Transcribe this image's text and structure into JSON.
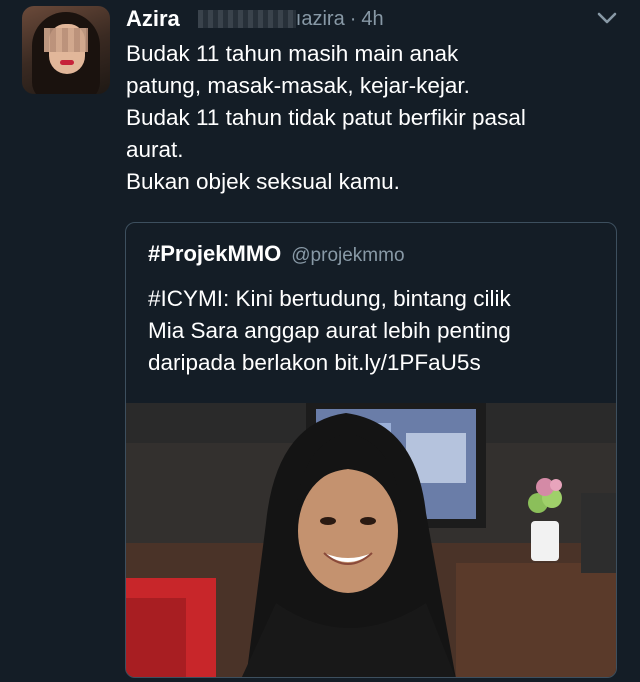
{
  "tweet": {
    "name": "Azira",
    "handle_visible": "ıazira",
    "separator": "·",
    "time": "4h",
    "lines": [
      "Budak 11 tahun masih main anak",
      "patung, masak-masak, kejar-kejar.",
      "Budak 11 tahun tidak patut berfikir pasal",
      "aurat.",
      "Bukan objek seksual kamu."
    ],
    "avatar_icon": "profile-photo",
    "menu_icon": "chevron-down-icon"
  },
  "quote": {
    "name": "#ProjekMMO",
    "handle": "@projekmmo",
    "lines": [
      "#ICYMI: Kini bertudung, bintang cilik",
      "Mia Sara anggap aurat lebih penting",
      "daripada berlakon bit.ly/1PFaU5s"
    ]
  },
  "colors": {
    "background": "#141d26",
    "secondary_text": "#8899a6",
    "border": "#3d4f5e"
  }
}
